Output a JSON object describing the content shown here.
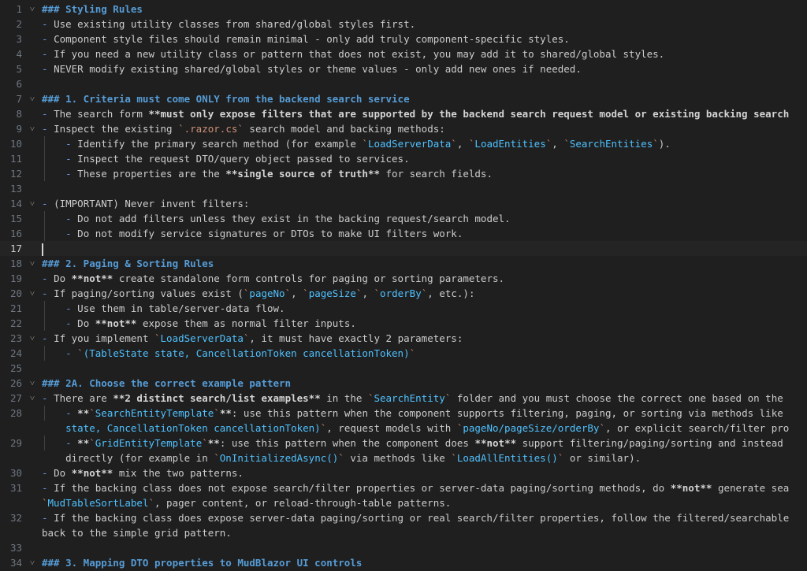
{
  "editor": {
    "current_line": 17,
    "lines": [
      {
        "n": "1",
        "fold": "˅",
        "segs": [
          [
            "h",
            "### Styling Rules"
          ]
        ]
      },
      {
        "n": "2",
        "fold": "",
        "segs": [
          [
            "dash",
            "- "
          ],
          [
            "t",
            "Use existing utility classes from shared/global styles first."
          ]
        ]
      },
      {
        "n": "3",
        "fold": "",
        "segs": [
          [
            "dash",
            "- "
          ],
          [
            "t",
            "Component style files should remain minimal - only add truly component-specific styles."
          ]
        ]
      },
      {
        "n": "4",
        "fold": "",
        "segs": [
          [
            "dash",
            "- "
          ],
          [
            "t",
            "If you need a new utility class or pattern that does not exist, you may add it to shared/global styles."
          ]
        ]
      },
      {
        "n": "5",
        "fold": "",
        "segs": [
          [
            "dash",
            "- "
          ],
          [
            "t",
            "NEVER modify existing shared/global styles or theme values - only add new ones if needed."
          ]
        ]
      },
      {
        "n": "6",
        "fold": "",
        "segs": []
      },
      {
        "n": "7",
        "fold": "˅",
        "segs": [
          [
            "h",
            "### 1. Criteria must come ONLY from the backend search service"
          ]
        ]
      },
      {
        "n": "8",
        "fold": "",
        "segs": [
          [
            "dash",
            "- "
          ],
          [
            "t",
            "The search form "
          ],
          [
            "b",
            "**must only expose filters that are supported by the backend search request model or existing backing search"
          ]
        ]
      },
      {
        "n": "9",
        "fold": "˅",
        "segs": [
          [
            "dash",
            "- "
          ],
          [
            "t",
            "Inspect the existing "
          ],
          [
            "c",
            "`.razor.cs`"
          ],
          [
            "t",
            " search model and backing methods:"
          ]
        ]
      },
      {
        "n": "10",
        "fold": "",
        "guide": true,
        "segs": [
          [
            "t",
            "    "
          ],
          [
            "dash",
            "- "
          ],
          [
            "t",
            "Identify the primary search method (for example "
          ],
          [
            "c",
            "`"
          ],
          [
            "c2",
            "LoadServerData"
          ],
          [
            "c",
            "`"
          ],
          [
            "t",
            ", "
          ],
          [
            "c",
            "`"
          ],
          [
            "c2",
            "LoadEntities"
          ],
          [
            "c",
            "`"
          ],
          [
            "t",
            ", "
          ],
          [
            "c",
            "`"
          ],
          [
            "c2",
            "SearchEntities"
          ],
          [
            "c",
            "`"
          ],
          [
            "t",
            ")."
          ]
        ]
      },
      {
        "n": "11",
        "fold": "",
        "guide": true,
        "segs": [
          [
            "t",
            "    "
          ],
          [
            "dash",
            "- "
          ],
          [
            "t",
            "Inspect the request DTO/query object passed to services."
          ]
        ]
      },
      {
        "n": "12",
        "fold": "",
        "guide": true,
        "segs": [
          [
            "t",
            "    "
          ],
          [
            "dash",
            "- "
          ],
          [
            "t",
            "These properties are the "
          ],
          [
            "b",
            "**single source of truth**"
          ],
          [
            "t",
            " for search fields."
          ]
        ]
      },
      {
        "n": "13",
        "fold": "",
        "segs": []
      },
      {
        "n": "14",
        "fold": "˅",
        "segs": [
          [
            "dash",
            "- "
          ],
          [
            "t",
            "(IMPORTANT) Never invent filters:"
          ]
        ]
      },
      {
        "n": "15",
        "fold": "",
        "guide": true,
        "segs": [
          [
            "t",
            "    "
          ],
          [
            "dash",
            "- "
          ],
          [
            "t",
            "Do not add filters unless they exist in the backing request/search model."
          ]
        ]
      },
      {
        "n": "16",
        "fold": "",
        "guide": true,
        "segs": [
          [
            "t",
            "    "
          ],
          [
            "dash",
            "- "
          ],
          [
            "t",
            "Do not modify service signatures or DTOs to make UI filters work."
          ]
        ]
      },
      {
        "n": "17",
        "fold": "",
        "cursor": true,
        "segs": []
      },
      {
        "n": "18",
        "fold": "˅",
        "segs": [
          [
            "h",
            "### 2. Paging & Sorting Rules"
          ]
        ]
      },
      {
        "n": "19",
        "fold": "",
        "segs": [
          [
            "dash",
            "- "
          ],
          [
            "t",
            "Do "
          ],
          [
            "b",
            "**not**"
          ],
          [
            "t",
            " create standalone form controls for paging or sorting parameters."
          ]
        ]
      },
      {
        "n": "20",
        "fold": "˅",
        "segs": [
          [
            "dash",
            "- "
          ],
          [
            "t",
            "If paging/sorting values exist ("
          ],
          [
            "c",
            "`"
          ],
          [
            "c2",
            "pageNo"
          ],
          [
            "c",
            "`"
          ],
          [
            "t",
            ", "
          ],
          [
            "c",
            "`"
          ],
          [
            "c2",
            "pageSize"
          ],
          [
            "c",
            "`"
          ],
          [
            "t",
            ", "
          ],
          [
            "c",
            "`"
          ],
          [
            "c2",
            "orderBy"
          ],
          [
            "c",
            "`"
          ],
          [
            "t",
            ", etc.):"
          ]
        ]
      },
      {
        "n": "21",
        "fold": "",
        "guide": true,
        "segs": [
          [
            "t",
            "    "
          ],
          [
            "dash",
            "- "
          ],
          [
            "t",
            "Use them in table/server-data flow."
          ]
        ]
      },
      {
        "n": "22",
        "fold": "",
        "guide": true,
        "segs": [
          [
            "t",
            "    "
          ],
          [
            "dash",
            "- "
          ],
          [
            "t",
            "Do "
          ],
          [
            "b",
            "**not**"
          ],
          [
            "t",
            " expose them as normal filter inputs."
          ]
        ]
      },
      {
        "n": "23",
        "fold": "˅",
        "segs": [
          [
            "dash",
            "- "
          ],
          [
            "t",
            "If you implement "
          ],
          [
            "c",
            "`"
          ],
          [
            "c2",
            "LoadServerData"
          ],
          [
            "c",
            "`"
          ],
          [
            "t",
            ", it must have exactly 2 parameters:"
          ]
        ]
      },
      {
        "n": "24",
        "fold": "",
        "guide": true,
        "segs": [
          [
            "t",
            "    "
          ],
          [
            "dash",
            "- "
          ],
          [
            "c",
            "`"
          ],
          [
            "c2",
            "(TableState state, CancellationToken cancellationToken)"
          ],
          [
            "c",
            "`"
          ]
        ]
      },
      {
        "n": "25",
        "fold": "",
        "segs": []
      },
      {
        "n": "26",
        "fold": "˅",
        "segs": [
          [
            "h",
            "### 2A. Choose the correct example pattern"
          ]
        ]
      },
      {
        "n": "27",
        "fold": "˅",
        "segs": [
          [
            "dash",
            "- "
          ],
          [
            "t",
            "There are "
          ],
          [
            "b",
            "**2 distinct search/list examples**"
          ],
          [
            "t",
            " in the "
          ],
          [
            "c",
            "`"
          ],
          [
            "c2",
            "SearchEntity"
          ],
          [
            "c",
            "`"
          ],
          [
            "t",
            " folder and you must choose the correct one based on the"
          ]
        ]
      },
      {
        "n": "28",
        "fold": "",
        "guide": true,
        "segs": [
          [
            "t",
            "    "
          ],
          [
            "dash",
            "- "
          ],
          [
            "b",
            "**"
          ],
          [
            "c",
            "`"
          ],
          [
            "c2",
            "SearchEntityTemplate"
          ],
          [
            "c",
            "`"
          ],
          [
            "b",
            "**"
          ],
          [
            "t",
            ": use this pattern when the component supports filtering, paging, or sorting via methods like"
          ]
        ]
      },
      {
        "n": "",
        "fold": "",
        "segs": [
          [
            "t",
            "    "
          ],
          [
            "c2",
            "state, CancellationToken cancellationToken)"
          ],
          [
            "c",
            "`"
          ],
          [
            "t",
            ", request models with "
          ],
          [
            "c",
            "`"
          ],
          [
            "c2",
            "pageNo/pageSize/orderBy"
          ],
          [
            "c",
            "`"
          ],
          [
            "t",
            ", or explicit search/filter pro"
          ]
        ]
      },
      {
        "n": "29",
        "fold": "",
        "guide": true,
        "segs": [
          [
            "t",
            "    "
          ],
          [
            "dash",
            "- "
          ],
          [
            "b",
            "**"
          ],
          [
            "c",
            "`"
          ],
          [
            "c2",
            "GridEntityTemplate"
          ],
          [
            "c",
            "`"
          ],
          [
            "b",
            "**"
          ],
          [
            "t",
            ": use this pattern when the component does "
          ],
          [
            "b",
            "**not**"
          ],
          [
            "t",
            " support filtering/paging/sorting and instead"
          ]
        ]
      },
      {
        "n": "",
        "fold": "",
        "segs": [
          [
            "t",
            "    directly (for example in "
          ],
          [
            "c",
            "`"
          ],
          [
            "c2",
            "OnInitializedAsync()"
          ],
          [
            "c",
            "`"
          ],
          [
            "t",
            " via methods like "
          ],
          [
            "c",
            "`"
          ],
          [
            "c2",
            "LoadAllEntities()"
          ],
          [
            "c",
            "`"
          ],
          [
            "t",
            " or similar)."
          ]
        ]
      },
      {
        "n": "30",
        "fold": "",
        "segs": [
          [
            "dash",
            "- "
          ],
          [
            "t",
            "Do "
          ],
          [
            "b",
            "**not**"
          ],
          [
            "t",
            " mix the two patterns."
          ]
        ]
      },
      {
        "n": "31",
        "fold": "",
        "segs": [
          [
            "dash",
            "- "
          ],
          [
            "t",
            "If the backing class does not expose search/filter properties or server-data paging/sorting methods, do "
          ],
          [
            "b",
            "**not**"
          ],
          [
            "t",
            " generate sea"
          ]
        ]
      },
      {
        "n": "",
        "fold": "",
        "segs": [
          [
            "c",
            "`"
          ],
          [
            "c2",
            "MudTableSortLabel"
          ],
          [
            "c",
            "`"
          ],
          [
            "t",
            ", pager content, or reload-through-table patterns."
          ]
        ]
      },
      {
        "n": "32",
        "fold": "",
        "segs": [
          [
            "dash",
            "- "
          ],
          [
            "t",
            "If the backing class does expose server-data paging/sorting or real search/filter properties, follow the filtered/searchable"
          ]
        ]
      },
      {
        "n": "",
        "fold": "",
        "segs": [
          [
            "t",
            "back to the simple grid pattern."
          ]
        ]
      },
      {
        "n": "33",
        "fold": "",
        "segs": []
      },
      {
        "n": "34",
        "fold": "˅",
        "segs": [
          [
            "h",
            "### 3. Mapping DTO properties to MudBlazor UI controls"
          ]
        ]
      }
    ]
  },
  "colors": {
    "background": "#1f1f1f",
    "heading": "#569cd6",
    "list_marker": "#6796e6",
    "inline_code": "#ce9178",
    "code_identifier": "#4fc1ff",
    "line_number": "#6e7681"
  }
}
